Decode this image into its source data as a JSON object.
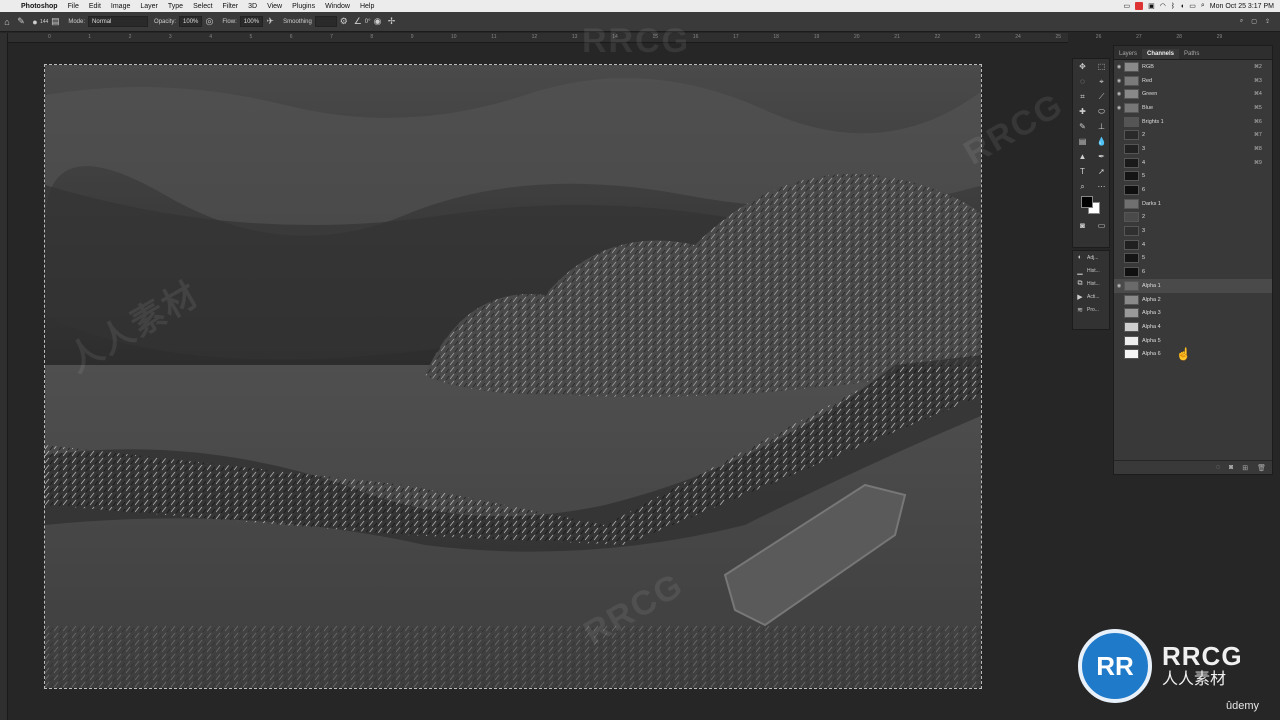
{
  "menubar": {
    "app_name": "Photoshop",
    "items": [
      "File",
      "Edit",
      "Image",
      "Layer",
      "Type",
      "Select",
      "Filter",
      "3D",
      "View",
      "Plugins",
      "Window",
      "Help"
    ],
    "clock": "Mon Oct 25  3:17 PM"
  },
  "options": {
    "brush_size": "144",
    "mode_label": "Mode:",
    "mode_value": "Normal",
    "opacity_label": "Opacity:",
    "opacity_value": "100%",
    "flow_label": "Flow:",
    "flow_value": "100%",
    "smoothing_label": "Smoothing",
    "angle_value": "0°"
  },
  "ruler_ticks": [
    "0",
    "1",
    "2",
    "3",
    "4",
    "5",
    "6",
    "7",
    "8",
    "9",
    "10",
    "11",
    "12",
    "13",
    "14",
    "15",
    "16",
    "17",
    "18",
    "19",
    "20",
    "21",
    "22",
    "23",
    "24",
    "25",
    "26",
    "27",
    "28",
    "29"
  ],
  "side_panels": [
    {
      "label": "Adj...",
      "icon": "adjustments-icon"
    },
    {
      "label": "Hist...",
      "icon": "histogram-icon"
    },
    {
      "label": "Hist...",
      "icon": "history-icon"
    },
    {
      "label": "Acti...",
      "icon": "actions-icon"
    },
    {
      "label": "Pro...",
      "icon": "properties-icon"
    }
  ],
  "panel": {
    "tabs": [
      "Layers",
      "Channels",
      "Paths"
    ],
    "active_tab": "Channels",
    "channels": [
      {
        "name": "RGB",
        "shortcut": "⌘2",
        "visible": true
      },
      {
        "name": "Red",
        "shortcut": "⌘3",
        "visible": true
      },
      {
        "name": "Green",
        "shortcut": "⌘4",
        "visible": true
      },
      {
        "name": "Blue",
        "shortcut": "⌘5",
        "visible": true
      },
      {
        "name": "Brights 1",
        "shortcut": "⌘6",
        "visible": false
      },
      {
        "name": "2",
        "shortcut": "⌘7",
        "visible": false
      },
      {
        "name": "3",
        "shortcut": "⌘8",
        "visible": false
      },
      {
        "name": "4",
        "shortcut": "⌘9",
        "visible": false
      },
      {
        "name": "5",
        "shortcut": "",
        "visible": false
      },
      {
        "name": "6",
        "shortcut": "",
        "visible": false
      },
      {
        "name": "Darks 1",
        "shortcut": "",
        "visible": false
      },
      {
        "name": "2",
        "shortcut": "",
        "visible": false
      },
      {
        "name": "3",
        "shortcut": "",
        "visible": false
      },
      {
        "name": "4",
        "shortcut": "",
        "visible": false
      },
      {
        "name": "5",
        "shortcut": "",
        "visible": false
      },
      {
        "name": "6",
        "shortcut": "",
        "visible": false
      },
      {
        "name": "Alpha 1",
        "shortcut": "",
        "visible": true,
        "selected": true
      },
      {
        "name": "Alpha 2",
        "shortcut": "",
        "visible": false
      },
      {
        "name": "Alpha 3",
        "shortcut": "",
        "visible": false
      },
      {
        "name": "Alpha 4",
        "shortcut": "",
        "visible": false
      },
      {
        "name": "Alpha 5",
        "shortcut": "",
        "visible": false
      },
      {
        "name": "Alpha 6",
        "shortcut": "",
        "visible": false
      }
    ]
  },
  "watermark": {
    "text": "RRCG",
    "cn": "人人素材"
  },
  "logo": {
    "mark": "RR",
    "text": "RRCG",
    "cn": "人人素材"
  },
  "udemy_label": "ûdemy"
}
